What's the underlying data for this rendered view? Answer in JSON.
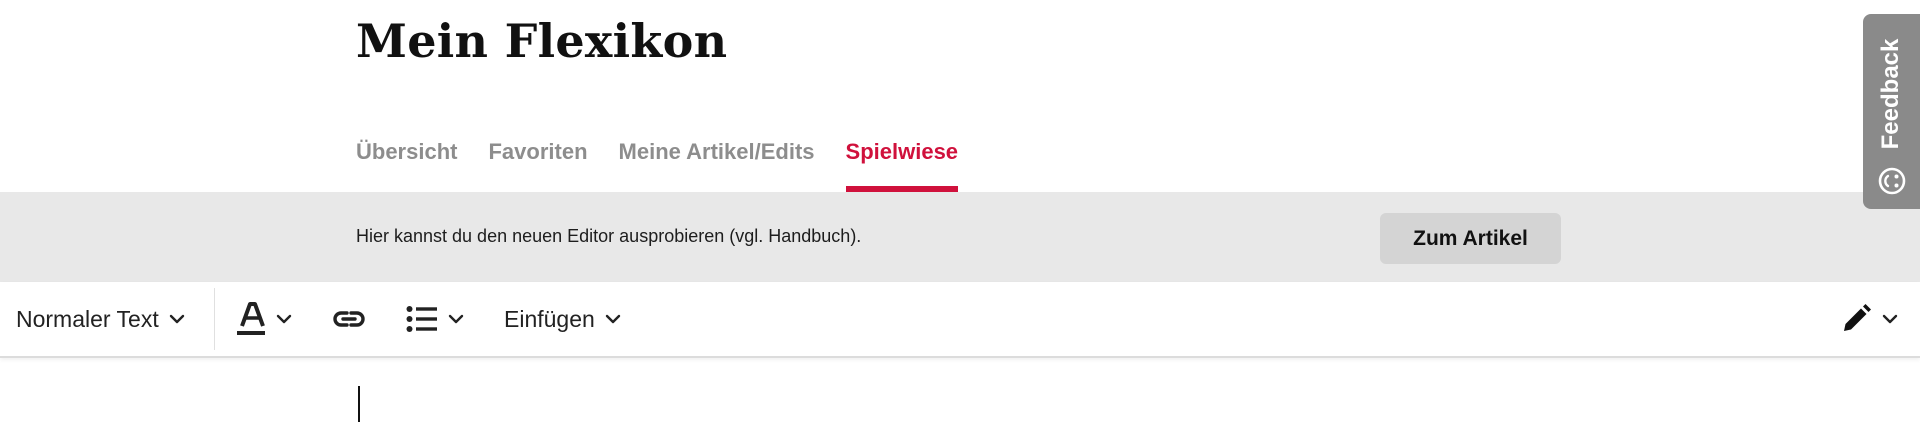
{
  "header": {
    "title": "Mein Flexikon"
  },
  "tabs": [
    {
      "label": "Übersicht",
      "active": false
    },
    {
      "label": "Favoriten",
      "active": false
    },
    {
      "label": "Meine Artikel/Edits",
      "active": false
    },
    {
      "label": "Spielwiese",
      "active": true
    }
  ],
  "info_bar": {
    "text": "Hier kannst du den neuen Editor ausprobieren (vgl. Handbuch).",
    "button_label": "Zum Artikel"
  },
  "toolbar": {
    "text_style_label": "Normaler Text",
    "insert_label": "Einfügen",
    "icons": [
      "chevron-down-icon",
      "text-style-icon",
      "link-icon",
      "list-icon",
      "pencil-icon"
    ]
  },
  "feedback": {
    "label": "Feedback",
    "icon": "smiley-icon"
  },
  "colors": {
    "accent": "#d0113c",
    "info_bar_bg": "#e8e8e8",
    "feedback_bg": "#8a8a8a",
    "inactive_tab": "#8d8d8d"
  }
}
